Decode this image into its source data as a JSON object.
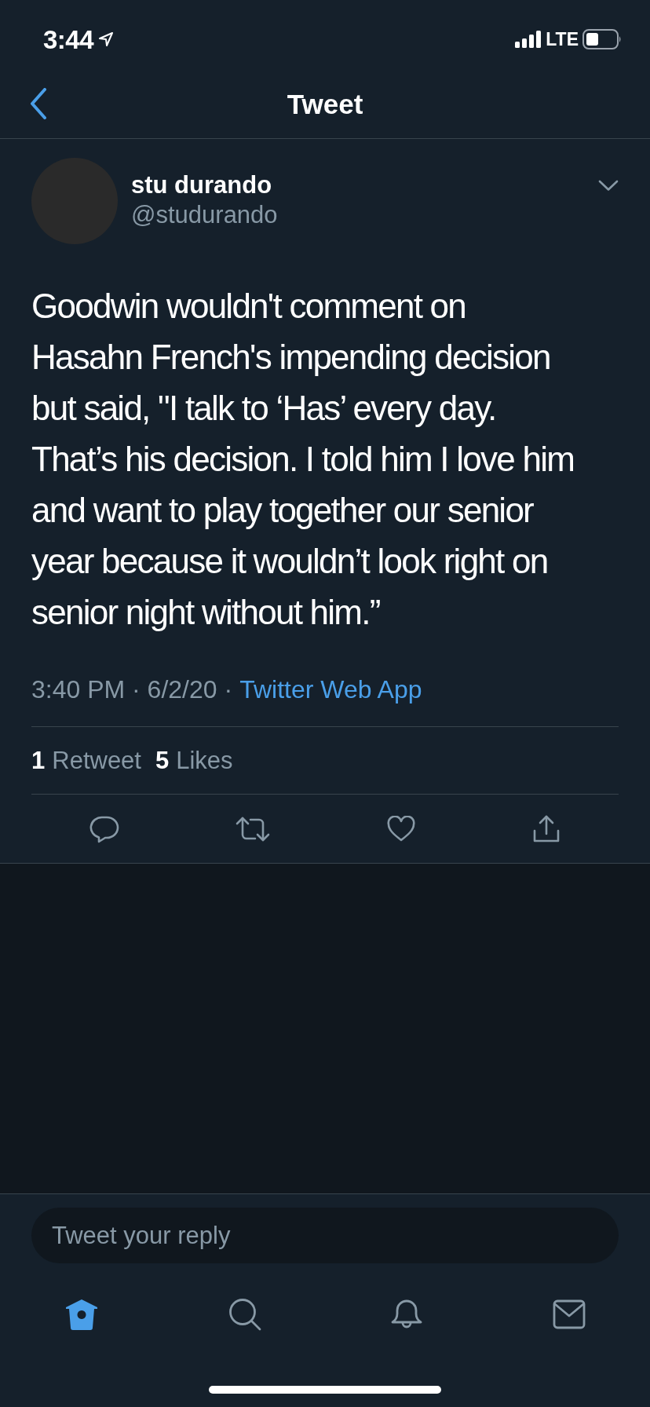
{
  "status_bar": {
    "time": "3:44",
    "network": "LTE"
  },
  "header": {
    "title": "Tweet"
  },
  "tweet": {
    "author": {
      "name": "stu durando",
      "handle": "@studurando"
    },
    "text": "Goodwin wouldn't comment on Hasahn French's impending decision but said, \"I talk to ‘Has’ every day. That’s his decision. I told him I love him and want to play together our senior year because it wouldn’t look right on senior night without him.”",
    "timestamp": "3:40 PM · 6/2/20 ·",
    "source": "Twitter Web App",
    "stats": [
      {
        "count": "1",
        "label": "Retweet"
      },
      {
        "count": "5",
        "label": "Likes"
      }
    ],
    "actions": [
      {
        "kind": "reply"
      },
      {
        "kind": "retweet"
      },
      {
        "kind": "like"
      },
      {
        "kind": "share"
      }
    ]
  },
  "reply_box": {
    "placeholder": "Tweet your reply"
  },
  "tab_bar": [
    {
      "kind": "home",
      "selected": true
    },
    {
      "kind": "search",
      "selected": false
    },
    {
      "kind": "notifications",
      "selected": false
    },
    {
      "kind": "messages",
      "selected": false
    }
  ]
}
